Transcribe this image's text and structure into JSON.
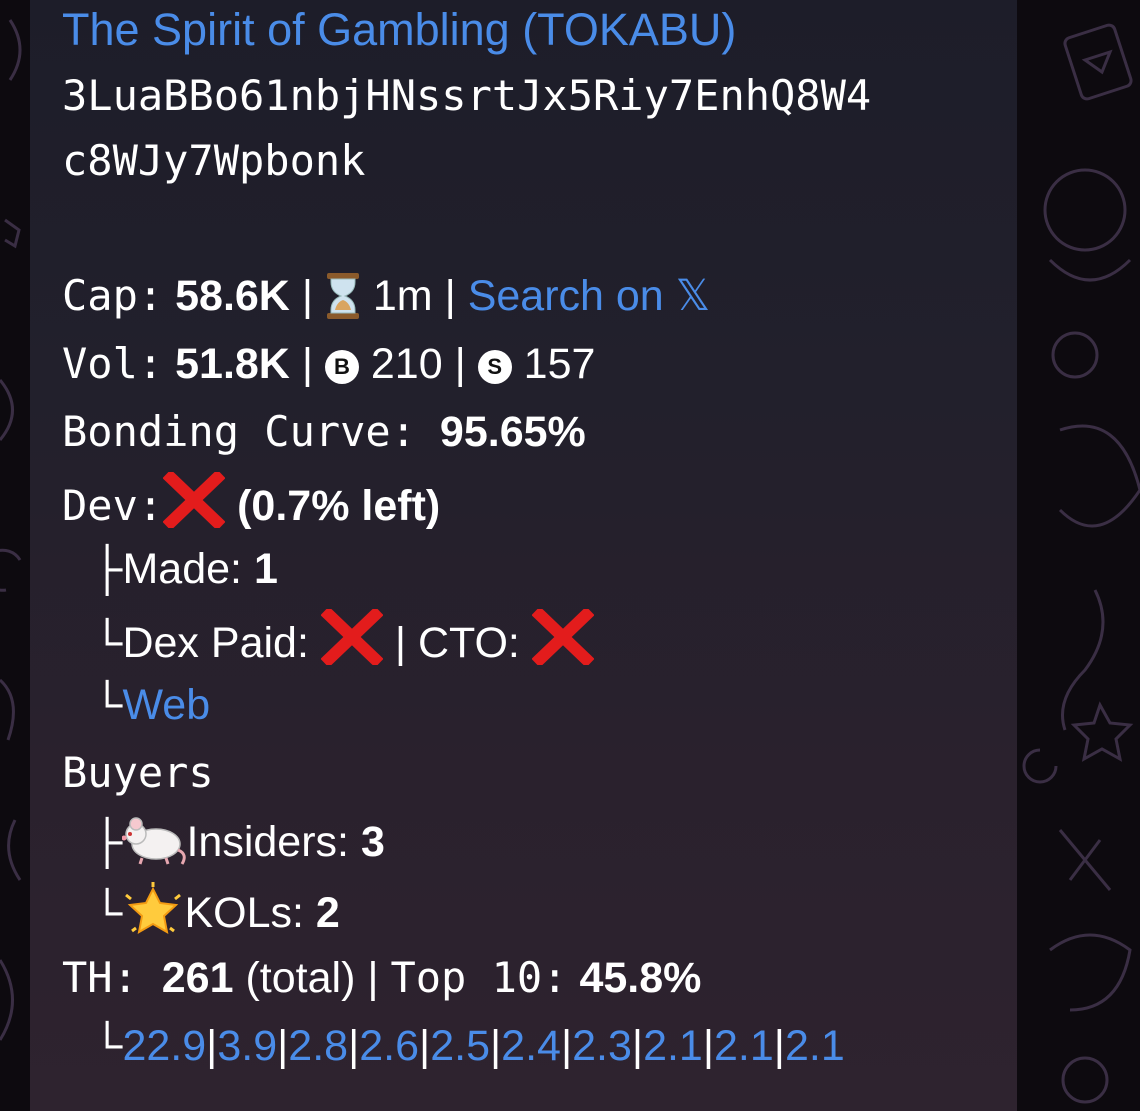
{
  "title": "The Spirit of Gambling (TOKABU)",
  "address": [
    "3LuaBBo61nbjHNssrtJx5Riy7EnhQ8W4",
    "c8WJy7Wpbonk"
  ],
  "cap": {
    "label": "Cap:",
    "value": "58.6K",
    "sep1": "|",
    "age": "1m",
    "sep2": "|",
    "search_link": "Search on 𝕏"
  },
  "vol": {
    "label": "Vol:",
    "value": "51.8K",
    "sep1": "|",
    "buy_badge": "B",
    "buys": "210",
    "sep2": "|",
    "sell_badge": "S",
    "sells": "157"
  },
  "bonding": {
    "label": "Bonding Curve:",
    "value": "95.65%"
  },
  "dev": {
    "label": "Dev:",
    "left": "(0.7% left)",
    "made_branch": "├",
    "made_label": "Made:",
    "made_value": "1",
    "dex_branch": "└",
    "dex_label": "Dex Paid:",
    "sep": "|",
    "cto_label": "CTO:",
    "web_branch": "└",
    "web_link": "Web"
  },
  "buyers": {
    "label": "Buyers",
    "insiders_branch": "├",
    "insiders_label": "Insiders:",
    "insiders_value": "3",
    "kols_branch": "└",
    "kols_label": "KOLs:",
    "kols_value": "2"
  },
  "th": {
    "label": "TH:",
    "total_value": "261",
    "total_suffix": "(total)",
    "sep": "|",
    "top_label": "Top 10:",
    "top_value": "45.8%",
    "branch": "└",
    "holders": [
      "22.9",
      "3.9",
      "2.8",
      "2.6",
      "2.5",
      "2.4",
      "2.3",
      "2.1",
      "2.1",
      "2.1"
    ]
  },
  "colors": {
    "link": "#4a8ce8",
    "x_mark": "#e31c1c",
    "text": "#ffffff"
  }
}
